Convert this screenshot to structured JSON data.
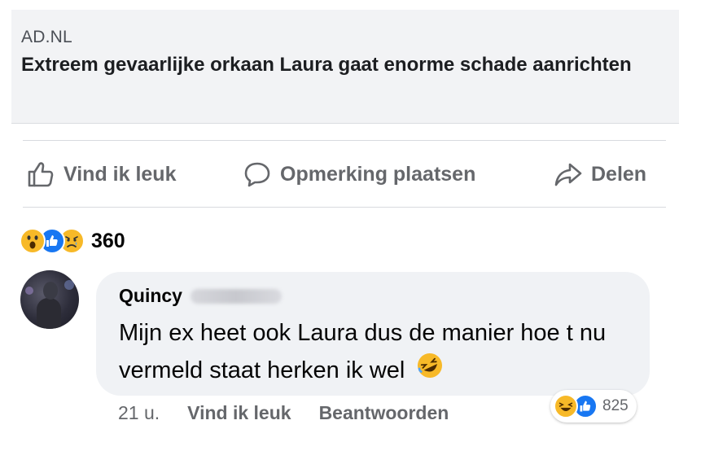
{
  "link_preview": {
    "domain": "AD.NL",
    "title": "Extreem gevaarlijke orkaan Laura gaat enorme schade aanrichten"
  },
  "actions": {
    "like_label": "Vind ik leuk",
    "comment_label": "Opmerking plaatsen",
    "share_label": "Delen"
  },
  "reactions": {
    "icons": [
      "wow-emoji-icon",
      "like-thumb-icon",
      "sad-emoji-icon"
    ],
    "count": "360"
  },
  "comment": {
    "author": "Quincy",
    "text": "Mijn ex heet ook Laura dus de manier hoe t nu vermeld staat herken ik wel",
    "emoji": "rolling-laughing-emoji-icon",
    "time": "21 u.",
    "like_label": "Vind ik leuk",
    "reply_label": "Beantwoorden",
    "reaction_icons": [
      "laughing-emoji-icon",
      "like-thumb-icon"
    ],
    "reaction_count": "825"
  },
  "colors": {
    "like_blue": "#1877f2",
    "emoji_yellow": "#f7b928",
    "muted_text": "#65676b",
    "bubble_bg": "#f0f2f5"
  }
}
